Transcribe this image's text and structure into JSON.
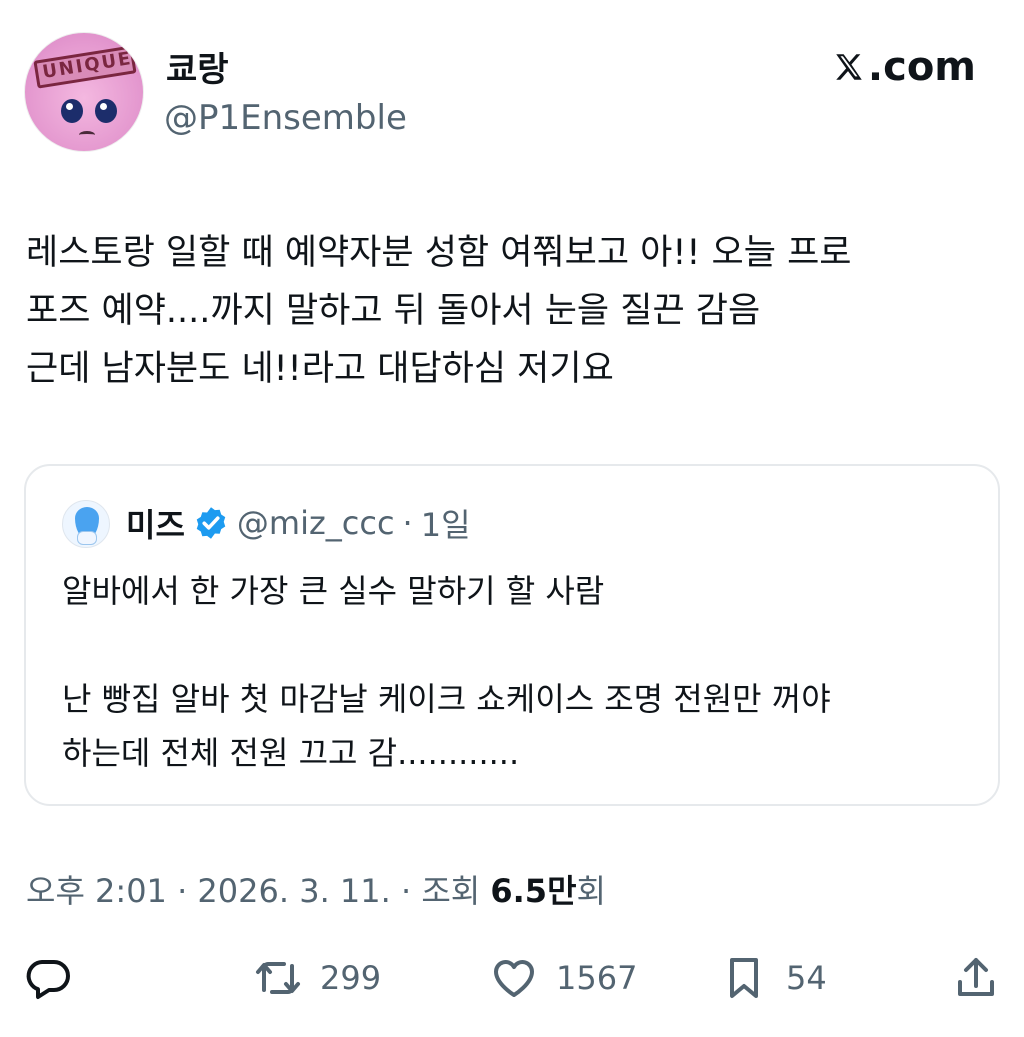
{
  "author": {
    "display_name": "쿄랑",
    "handle": "@P1Ensemble",
    "avatar_text": "UNIQUE"
  },
  "brand": {
    "label": ".com",
    "icon": "x-logo-icon"
  },
  "tweet": {
    "lines": [
      "레스토랑 일할 때 예약자분 성함 여쭤보고 아!! 오늘 프로",
      "포즈 예약....까지 말하고 뒤 돌아서 눈을 질끈 감음",
      "근데 남자분도 네!!라고 대답하심 저기요"
    ]
  },
  "quote": {
    "display_name": "미즈",
    "verified": true,
    "handle": "@miz_ccc",
    "separator": "·",
    "age": "1일",
    "paragraph1": "알바에서 한 가장 큰 실수 말하기 할 사람",
    "paragraph2_lines": [
      "난 빵집 알바 첫 마감날 케이크 쇼케이스 조명 전원만 꺼야",
      "하는데 전체 전원 끄고 감............"
    ]
  },
  "meta": {
    "time": "오후 2:01 · 2026. 3. 11. · 조회 ",
    "views_bold": "6.5만",
    "views_suffix": "회"
  },
  "actions": {
    "reply_count": "",
    "retweet_count": "299",
    "like_count": "1567",
    "bookmark_count": "54"
  },
  "colors": {
    "text": "#0f1419",
    "secondary": "#536471",
    "verified": "#1d9bf0",
    "border": "#e6e9ec"
  }
}
